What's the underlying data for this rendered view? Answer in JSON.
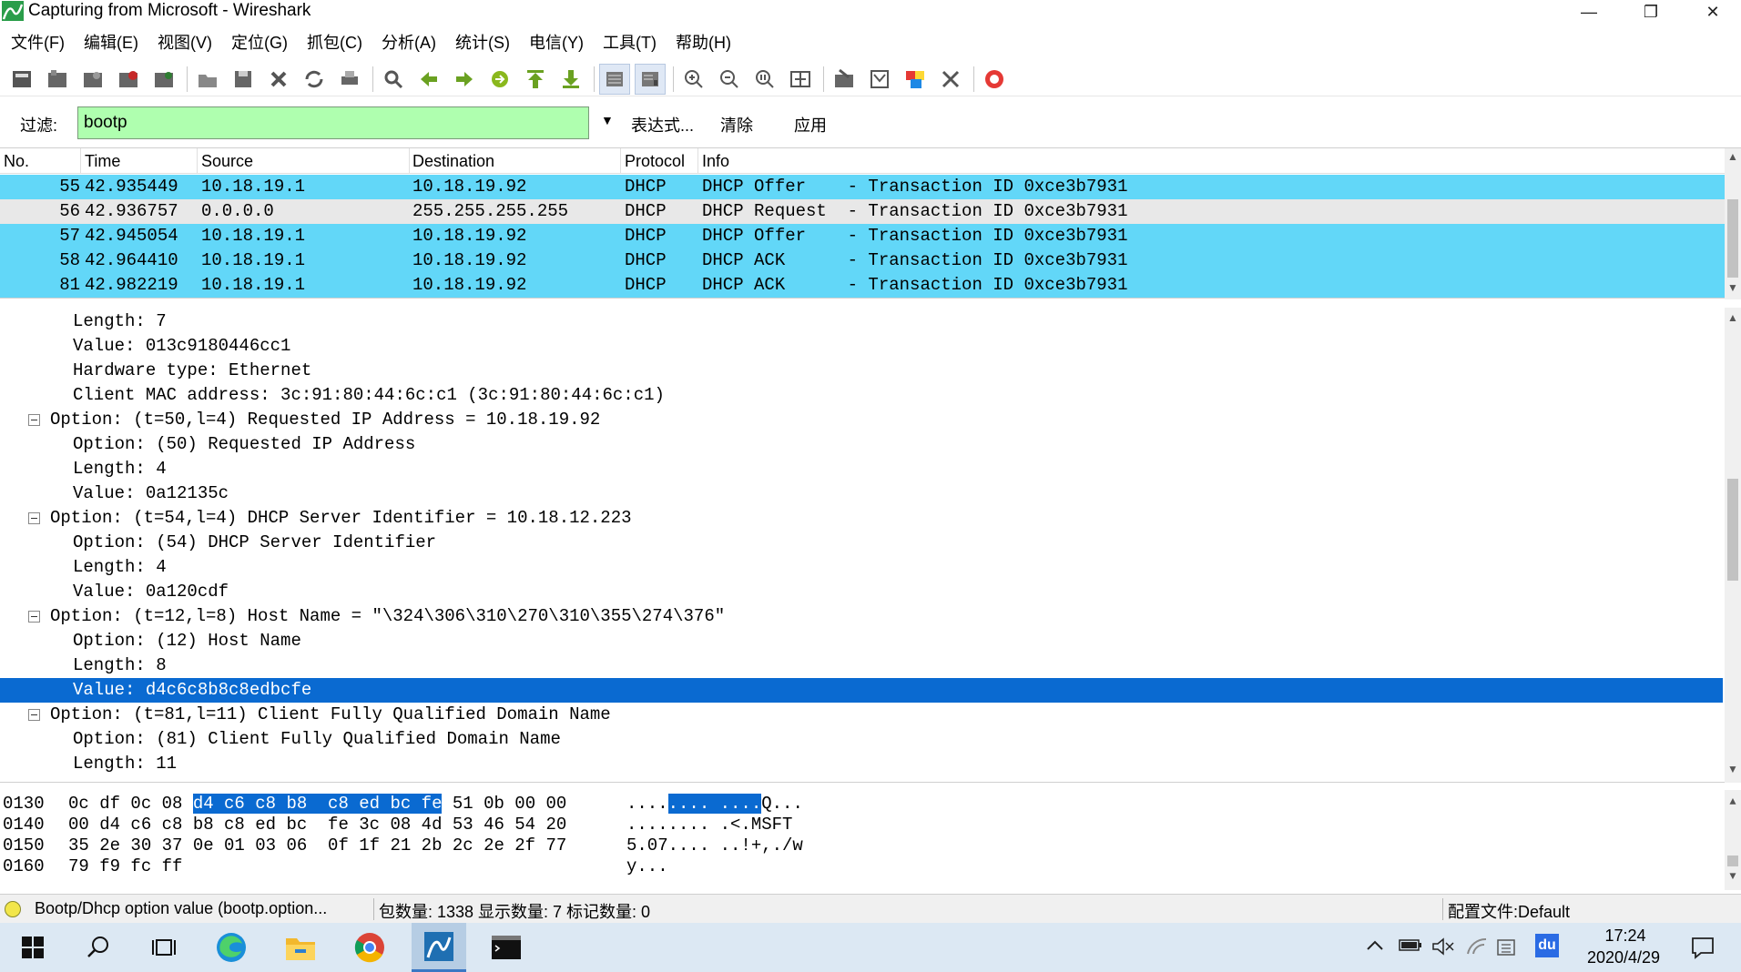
{
  "window": {
    "title": "Capturing from Microsoft - Wireshark",
    "minimize": "—",
    "maximize": "❐",
    "close": "✕"
  },
  "menu": [
    "文件(F)",
    "编辑(E)",
    "视图(V)",
    "定位(G)",
    "抓包(C)",
    "分析(A)",
    "统计(S)",
    "电信(Y)",
    "工具(T)",
    "帮助(H)"
  ],
  "filter": {
    "label": "过滤:",
    "value": "bootp",
    "expression": "表达式...",
    "clear": "清除",
    "apply": "应用",
    "dropdown": "▼"
  },
  "packet_list": {
    "columns": [
      "No.",
      "Time",
      "Source",
      "Destination",
      "Protocol",
      "Info"
    ],
    "rows": [
      {
        "no": "55",
        "time": "42.935449",
        "src": "10.18.19.1",
        "dst": "10.18.19.92",
        "proto": "DHCP",
        "info": "DHCP Offer    - Transaction ID 0xce3b7931",
        "color": "#62d7f8"
      },
      {
        "no": "56",
        "time": "42.936757",
        "src": "0.0.0.0",
        "dst": "255.255.255.255",
        "proto": "DHCP",
        "info": "DHCP Request  - Transaction ID 0xce3b7931",
        "color": "#e8e8e8"
      },
      {
        "no": "57",
        "time": "42.945054",
        "src": "10.18.19.1",
        "dst": "10.18.19.92",
        "proto": "DHCP",
        "info": "DHCP Offer    - Transaction ID 0xce3b7931",
        "color": "#62d7f8"
      },
      {
        "no": "58",
        "time": "42.964410",
        "src": "10.18.19.1",
        "dst": "10.18.19.92",
        "proto": "DHCP",
        "info": "DHCP ACK      - Transaction ID 0xce3b7931",
        "color": "#62d7f8"
      },
      {
        "no": "81",
        "time": "42.982219",
        "src": "10.18.19.1",
        "dst": "10.18.19.92",
        "proto": "DHCP",
        "info": "DHCP ACK      - Transaction ID 0xce3b7931",
        "color": "#62d7f8"
      }
    ]
  },
  "details": {
    "lines": [
      {
        "text": "Length: 7",
        "indent": 2,
        "expander": false
      },
      {
        "text": "Value: 013c9180446cc1",
        "indent": 2,
        "expander": false
      },
      {
        "text": "Hardware type: Ethernet",
        "indent": 2,
        "expander": false
      },
      {
        "text": "Client MAC address: 3c:91:80:44:6c:c1 (3c:91:80:44:6c:c1)",
        "indent": 2,
        "expander": false
      },
      {
        "text": "Option: (t=50,l=4) Requested IP Address = 10.18.19.92",
        "indent": 1,
        "expander": true
      },
      {
        "text": "Option: (50) Requested IP Address",
        "indent": 2,
        "expander": false
      },
      {
        "text": "Length: 4",
        "indent": 2,
        "expander": false
      },
      {
        "text": "Value: 0a12135c",
        "indent": 2,
        "expander": false
      },
      {
        "text": "Option: (t=54,l=4) DHCP Server Identifier = 10.18.12.223",
        "indent": 1,
        "expander": true
      },
      {
        "text": "Option: (54) DHCP Server Identifier",
        "indent": 2,
        "expander": false
      },
      {
        "text": "Length: 4",
        "indent": 2,
        "expander": false
      },
      {
        "text": "Value: 0a120cdf",
        "indent": 2,
        "expander": false
      },
      {
        "text": "Option: (t=12,l=8) Host Name = \"\\324\\306\\310\\270\\310\\355\\274\\376\"",
        "indent": 1,
        "expander": true
      },
      {
        "text": "Option: (12) Host Name",
        "indent": 2,
        "expander": false
      },
      {
        "text": "Length: 8",
        "indent": 2,
        "expander": false
      },
      {
        "text": "Value: d4c6c8b8c8edbcfe",
        "indent": 2,
        "expander": false,
        "selected": true
      },
      {
        "text": "Option: (t=81,l=11) Client Fully Qualified Domain Name",
        "indent": 1,
        "expander": true
      },
      {
        "text": "Option: (81) Client Fully Qualified Domain Name",
        "indent": 2,
        "expander": false
      },
      {
        "text": "Length: 11",
        "indent": 2,
        "expander": false
      }
    ]
  },
  "bytes": {
    "lines": [
      {
        "offset": "0130",
        "pre": "0c df 0c 08 ",
        "hl": "d4 c6 c8 b8  c8 ed bc fe",
        "post": " 51 0b 00 00",
        "ascii_pre": "....",
        "ascii_hl": ".... ....",
        "ascii_post": "Q..."
      },
      {
        "offset": "0140",
        "pre": "00 d4 c6 c8 b8 c8 ed bc  fe 3c 08 4d 53 46 54 20",
        "hl": "",
        "post": "",
        "ascii_pre": "........ .<.MSFT",
        "ascii_hl": "",
        "ascii_post": ""
      },
      {
        "offset": "0150",
        "pre": "35 2e 30 37 0e 01 03 06  0f 1f 21 2b 2c 2e 2f 77",
        "hl": "",
        "post": "",
        "ascii_pre": "5.07.... ..!+,./w",
        "ascii_hl": "",
        "ascii_post": ""
      },
      {
        "offset": "0160",
        "pre": "79 f9 fc ff",
        "hl": "",
        "post": "",
        "ascii_pre": "y...",
        "ascii_hl": "",
        "ascii_post": ""
      }
    ]
  },
  "status": {
    "field": "Bootp/Dhcp option value (bootp.option...",
    "counts": "包数量: 1338 显示数量: 7 标记数量: 0",
    "profile": "配置文件:Default"
  },
  "taskbar": {
    "time": "17:24",
    "date": "2020/4/29",
    "ime": "du"
  }
}
